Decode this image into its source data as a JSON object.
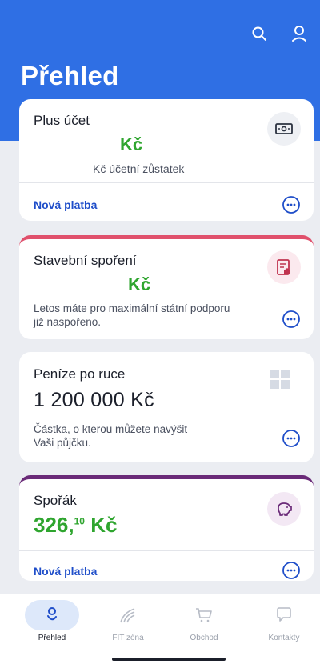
{
  "header": {
    "title": "Přehled",
    "icons": [
      "search-icon",
      "user-icon"
    ]
  },
  "cards": {
    "plus": {
      "title": "Plus účet",
      "amount": "Kč",
      "balance_label": "Kč účetní zůstatek",
      "link": "Nová platba",
      "icon": "money-icon"
    },
    "stavebni": {
      "title": "Stavební spoření",
      "amount": "Kč",
      "description": "Letos máte pro maximální státní podporu již naspořeno.",
      "description_line1": "Letos máte pro maximální státní podporu",
      "description_line2": "již naspořeno.",
      "icon": "document-house-icon",
      "accent": "#e0506c"
    },
    "penize": {
      "title": "Peníze po ruce",
      "amount": "1 200 000 Kč",
      "description_line1": "Částka, o kterou můžete navýšit",
      "description_line2": "Vaši půjčku.",
      "icon": "grid-icon"
    },
    "sporak": {
      "title": "Spořák",
      "amount_whole": "326,",
      "amount_decimal": "10",
      "amount_currency": "Kč",
      "link": "Nová platba",
      "icon": "piggy-bank-icon",
      "accent": "#6a2a78"
    }
  },
  "tabs": [
    {
      "label": "Přehled",
      "icon": "overview-icon",
      "active": true
    },
    {
      "label": "FIT zóna",
      "icon": "fit-zone-icon",
      "active": false
    },
    {
      "label": "Obchod",
      "icon": "cart-icon",
      "active": false
    },
    {
      "label": "Kontakty",
      "icon": "chat-icon",
      "active": false
    }
  ],
  "colors": {
    "brand": "#2f6fe4",
    "link": "#1f4ec9",
    "amount_green": "#2fa52f",
    "background": "#ebedf2"
  }
}
